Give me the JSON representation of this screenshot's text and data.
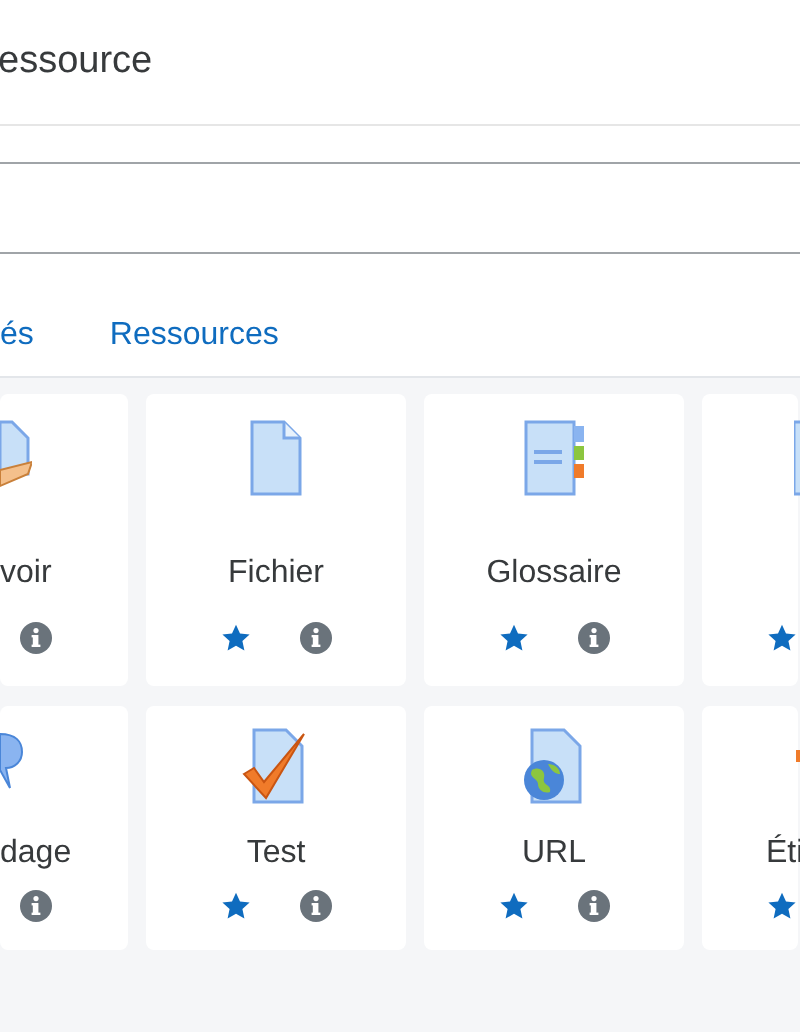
{
  "title": "essource",
  "tabs": [
    {
      "label": "és",
      "selected": false
    },
    {
      "label": "Ressources",
      "selected": false
    }
  ],
  "rows": [
    [
      {
        "label": "voir"
      },
      {
        "label": "Fichier",
        "starred": true
      },
      {
        "label": "Glossaire",
        "starred": true
      },
      {
        "starred": true
      }
    ],
    [
      {
        "label": "dage"
      },
      {
        "label": "Test",
        "starred": true
      },
      {
        "label": "URL",
        "starred": true
      },
      {
        "label": "Éti",
        "starred": true
      }
    ]
  ]
}
